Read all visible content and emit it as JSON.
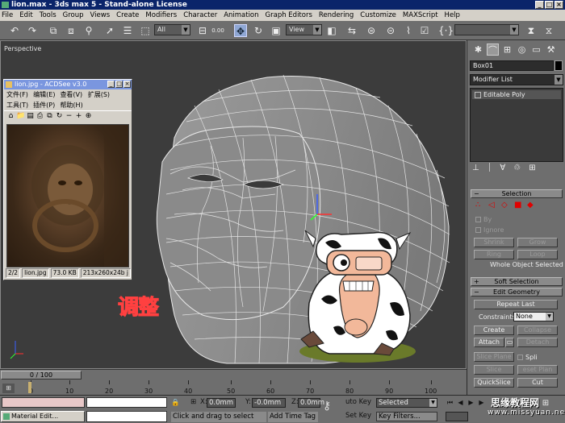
{
  "window": {
    "title": "lion.max - 3ds max 5 - Stand-alone License",
    "min_btn": "_",
    "max_btn": "□",
    "close_btn": "×"
  },
  "menubar": [
    "File",
    "Edit",
    "Tools",
    "Group",
    "Views",
    "Create",
    "Modifiers",
    "Character",
    "Animation",
    "Graph Editors",
    "Rendering",
    "Customize",
    "MAXScript",
    "Help"
  ],
  "toolbar": {
    "selection_filter": "All",
    "reference_coord": "View",
    "snap_value": "0.00"
  },
  "viewport": {
    "label": "Perspective",
    "annotation": "调整"
  },
  "acdsee": {
    "title": "lion.jpg - ACDSee v3.0",
    "menu": [
      "文件(F)",
      "编辑(E)",
      "查看(V)",
      "扩展(S)",
      "工具(T)",
      "插件(P)",
      "帮助(H)"
    ],
    "status": [
      "2/2",
      "lion.jpg",
      "73.0 KB",
      "213x260x24b j"
    ]
  },
  "command_panel": {
    "object_name": "Box01",
    "modifier_list": "Modifier List",
    "stack_item": "Editable Poly",
    "rollout_selection": "Selection",
    "by_label": "By",
    "ignore_label": "Ignore",
    "shrink": "Shrink",
    "grow": "Grow",
    "ring": "Ring",
    "loop": "Loop",
    "whole_object": "Whole Object Selected",
    "rollout_soft": "Soft Selection",
    "rollout_edit": "Edit Geometry",
    "repeat_last": "Repeat Last",
    "constraints_label": "Constraints:",
    "constraints_value": "None",
    "create": "Create",
    "collapse": "Collapse",
    "attach": "Attach",
    "detach": "Detach",
    "slice_plane": "Slice Plane",
    "split": "Spli",
    "slice": "Slice",
    "reset_plane": "eset Plan",
    "quickslice": "QuickSlice",
    "cut": "Cut"
  },
  "timeline": {
    "frame_display": "0 / 100",
    "ticks": [
      "0",
      "10",
      "20",
      "30",
      "40",
      "50",
      "60",
      "70",
      "80",
      "90",
      "100"
    ]
  },
  "statusbar": {
    "taskbar_item": "Material Edit...",
    "x_label": "X:",
    "x_value": "0.0mm",
    "y_label": "Y:",
    "y_value": "-0.0mm",
    "z_label": "Z:",
    "z_value": "0.0mm",
    "prompt": "Click and drag to select",
    "add_time_tag": "Add Time Tag",
    "auto_key": "uto Key",
    "set_key": "Set Key",
    "selected": "Selected",
    "key_filters": "Key Filters..."
  },
  "watermark": {
    "cn": "思缘教程网",
    "url": "www.missyuan.net"
  },
  "icons": {
    "undo": "undo-icon",
    "redo": "redo-icon",
    "move": "move-icon"
  },
  "colors": {
    "viewport_bg": "#3c3c3c",
    "panel_bg": "#6e6e6e",
    "title_bg": "#0a246a",
    "annotation_red": "#c00000"
  }
}
